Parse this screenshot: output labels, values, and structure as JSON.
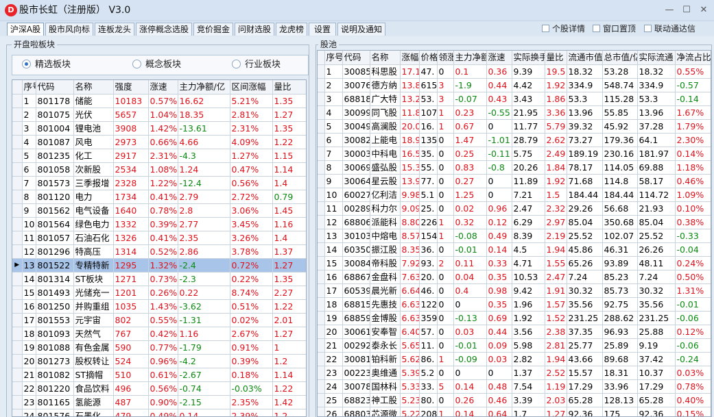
{
  "window": {
    "logo": "D",
    "title": "股市长虹（注册版） V3.0",
    "controls": {
      "minimize": "—",
      "maximize": "☐",
      "close": "✕"
    }
  },
  "tabs": [
    "沪深A股",
    "股市风向标",
    "连板龙头",
    "涨停概念选股",
    "竞价掘金",
    "问财选股",
    "龙虎榜",
    "设置",
    "说明及通知"
  ],
  "active_tab": 0,
  "options": [
    "个股详情",
    "窗口置顶",
    "联动通达信"
  ],
  "left_panel": {
    "caption": "开盘啦板块",
    "radios": [
      {
        "label": "精选板块",
        "checked": true
      },
      {
        "label": "概念板块",
        "checked": false
      },
      {
        "label": "行业板块",
        "checked": false
      }
    ],
    "columns": [
      "序号",
      "代码",
      "名称",
      "强度",
      "涨速",
      "主力净额/亿",
      "区间涨幅",
      "量比"
    ],
    "selected_index": 12,
    "rows": [
      [
        "1",
        "801178",
        "储能",
        "10183",
        "0.57%",
        "16.62",
        "5.21%",
        "1.35"
      ],
      [
        "2",
        "801075",
        "光伏",
        "5657",
        "1.04%",
        "18.35",
        "2.81%",
        "1.27"
      ],
      [
        "3",
        "801004",
        "锂电池",
        "3908",
        "1.42%",
        "-13.61",
        "2.31%",
        "1.35"
      ],
      [
        "4",
        "801087",
        "风电",
        "2973",
        "0.66%",
        "4.66",
        "4.09%",
        "1.22"
      ],
      [
        "5",
        "801235",
        "化工",
        "2917",
        "2.31%",
        "-4.3",
        "1.27%",
        "1.15"
      ],
      [
        "6",
        "801058",
        "次新股",
        "2534",
        "1.08%",
        "1.24",
        "0.47%",
        "1.14"
      ],
      [
        "7",
        "801573",
        "三季报增",
        "2328",
        "1.22%",
        "-12.4",
        "0.56%",
        "1.4"
      ],
      [
        "8",
        "801120",
        "电力",
        "1734",
        "0.41%",
        "2.79",
        "2.72%",
        "0.79"
      ],
      [
        "9",
        "801562",
        "电气设备",
        "1640",
        "0.78%",
        "2.8",
        "3.06%",
        "1.45"
      ],
      [
        "10",
        "801564",
        "绿色电力",
        "1332",
        "0.39%",
        "2.77",
        "3.45%",
        "1.16"
      ],
      [
        "11",
        "801057",
        "石油石化",
        "1326",
        "0.41%",
        "2.35",
        "3.26%",
        "1.4"
      ],
      [
        "12",
        "801296",
        "特高压",
        "1314",
        "0.52%",
        "2.86",
        "3.78%",
        "1.37"
      ],
      [
        "13",
        "801522",
        "专精特新",
        "1295",
        "1.32%",
        "-2.4",
        "0.72%",
        "1.27"
      ],
      [
        "14",
        "801314",
        "ST板块",
        "1271",
        "0.73%",
        "-2.3",
        "0.22%",
        "1.35"
      ],
      [
        "15",
        "801493",
        "光储充一",
        "1201",
        "0.26%",
        "0.22",
        "8.74%",
        "2.27"
      ],
      [
        "16",
        "801250",
        "并购重组",
        "1035",
        "1.43%",
        "-3.62",
        "0.51%",
        "1.22"
      ],
      [
        "17",
        "801553",
        "元宇宙",
        "802",
        "0.55%",
        "-1.31",
        "0.02%",
        "2.01"
      ],
      [
        "18",
        "801093",
        "天然气",
        "767",
        "0.42%",
        "1.16",
        "2.67%",
        "1.27"
      ],
      [
        "19",
        "801088",
        "有色金属",
        "590",
        "0.77%",
        "-1.79",
        "0.91%",
        "1"
      ],
      [
        "20",
        "801273",
        "股权转让",
        "524",
        "0.96%",
        "-4.2",
        "0.39%",
        "1.2"
      ],
      [
        "21",
        "801082",
        "ST摘帽",
        "510",
        "0.61%",
        "-2.67",
        "0.18%",
        "1.14"
      ],
      [
        "22",
        "801220",
        "食品饮料",
        "496",
        "0.56%",
        "-0.74",
        "-0.03%",
        "1.22"
      ],
      [
        "23",
        "801165",
        "氢能源",
        "487",
        "0.90%",
        "-2.15",
        "2.35%",
        "1.42"
      ],
      [
        "24",
        "801576",
        "石墨化",
        "479",
        "0.49%",
        "0.14",
        "2.39%",
        "1.2"
      ]
    ]
  },
  "right_panel": {
    "caption": "股池",
    "columns": [
      "序号",
      "代码",
      "名称",
      "涨幅",
      "价格",
      "领涨",
      "主力净额",
      "涨速",
      "实际换手",
      "量比",
      "流通市值",
      "总市值/亿",
      "实际流通",
      "净流占比"
    ],
    "rows": [
      [
        "1",
        "30085",
        "科思股",
        "17.1",
        "47.",
        "0",
        "0.1",
        "0.36",
        "9.39",
        "19.5",
        "18.32",
        "53.28",
        "18.32",
        "0.55%"
      ],
      [
        "2",
        "30076",
        "德方纳",
        "13.8",
        "615",
        "3",
        "-1.9",
        "0.44",
        "4.42",
        "1.92",
        "334.9",
        "548.74",
        "334.9",
        "-0.57"
      ],
      [
        "3",
        "68818",
        "广大特",
        "13.2",
        "53.",
        "3",
        "-0.07",
        "0.43",
        "3.43",
        "1.86",
        "53.3",
        "115.28",
        "53.3",
        "-0.14"
      ],
      [
        "4",
        "30099",
        "同飞股",
        "11.8",
        "107",
        "1",
        "0.23",
        "-0.55",
        "21.95",
        "3.36",
        "13.96",
        "55.85",
        "13.96",
        "1.67%"
      ],
      [
        "5",
        "30049",
        "高澜股",
        "20.0",
        "16.",
        "1",
        "0.67",
        "0",
        "11.77",
        "5.79",
        "39.32",
        "45.92",
        "37.28",
        "1.79%"
      ],
      [
        "6",
        "30082",
        "上能电",
        "18.9",
        "135",
        "0",
        "1.47",
        "-1.01",
        "28.79",
        "2.62",
        "73.27",
        "179.36",
        "64.1",
        "2.30%"
      ],
      [
        "7",
        "30003",
        "中科电",
        "16.5",
        "35.",
        "0",
        "0.25",
        "-0.11",
        "5.75",
        "2.49",
        "189.19",
        "230.16",
        "181.97",
        "0.14%"
      ],
      [
        "8",
        "30069",
        "盛弘股",
        "15.3",
        "55.",
        "0",
        "0.83",
        "-0.8",
        "20.26",
        "1.84",
        "78.17",
        "114.05",
        "69.88",
        "1.18%"
      ],
      [
        "9",
        "30064",
        "星云股",
        "13.9",
        "77.",
        "0",
        "0.27",
        "0",
        "11.89",
        "1.92",
        "71.68",
        "114.8",
        "58.17",
        "0.46%"
      ],
      [
        "10",
        "60027",
        "亿利洁",
        "9.98",
        "5.1",
        "0",
        "1.25",
        "0",
        "7.21",
        "1.5",
        "184.44",
        "184.44",
        "114.72",
        "1.09%"
      ],
      [
        "11",
        "00289",
        "科力尔",
        "9.09",
        "25.",
        "0",
        "0.02",
        "0.96",
        "2.47",
        "2.32",
        "29.26",
        "56.68",
        "21.93",
        "0.10%"
      ],
      [
        "12",
        "68806",
        "派能科",
        "8.80",
        "226",
        "1",
        "0.32",
        "0.12",
        "6.29",
        "2.97",
        "85.04",
        "350.68",
        "85.04",
        "0.38%"
      ],
      [
        "13",
        "30103",
        "中熔电",
        "8.57",
        "154",
        "1",
        "-0.08",
        "0.49",
        "8.39",
        "2.19",
        "25.52",
        "102.07",
        "25.52",
        "-0.33"
      ],
      [
        "14",
        "60350",
        "振江股",
        "8.35",
        "36.",
        "0",
        "-0.01",
        "0.14",
        "4.5",
        "1.94",
        "45.86",
        "46.31",
        "26.26",
        "-0.04"
      ],
      [
        "15",
        "30084",
        "帝科股",
        "7.92",
        "93.",
        "2",
        "0.11",
        "0.33",
        "4.71",
        "1.55",
        "65.26",
        "93.89",
        "48.11",
        "0.24%"
      ],
      [
        "16",
        "68867",
        "金盘科",
        "7.63",
        "20.",
        "0",
        "0.04",
        "0.35",
        "10.53",
        "2.47",
        "7.24",
        "85.23",
        "7.24",
        "0.50%"
      ],
      [
        "17",
        "60539",
        "晨光新",
        "6.64",
        "46.",
        "0",
        "0.4",
        "0.98",
        "9.42",
        "1.91",
        "30.32",
        "85.73",
        "30.32",
        "1.31%"
      ],
      [
        "18",
        "68815",
        "先惠技",
        "6.63",
        "122",
        "0",
        "0",
        "0.35",
        "1.96",
        "1.57",
        "35.56",
        "92.75",
        "35.56",
        "-0.01"
      ],
      [
        "19",
        "68859",
        "金博股",
        "6.63",
        "359",
        "0",
        "-0.13",
        "0.69",
        "1.92",
        "1.52",
        "231.25",
        "288.62",
        "231.25",
        "-0.06"
      ],
      [
        "20",
        "30061",
        "安奉智",
        "6.40",
        "57.",
        "0",
        "0.03",
        "0.44",
        "3.56",
        "2.38",
        "37.35",
        "96.93",
        "25.88",
        "0.12%"
      ],
      [
        "21",
        "00292",
        "泰永长",
        "5.65",
        "11.",
        "0",
        "-0.01",
        "0.09",
        "5.98",
        "2.81",
        "25.77",
        "25.89",
        "9.19",
        "-0.06"
      ],
      [
        "22",
        "30081",
        "铂科新",
        "5.62",
        "86.",
        "1",
        "-0.09",
        "0.03",
        "2.82",
        "1.94",
        "43.66",
        "89.68",
        "37.42",
        "-0.24"
      ],
      [
        "23",
        "00223",
        "奥维通",
        "5.39",
        "5.2",
        "0",
        "0",
        "0",
        "1.37",
        "2.52",
        "15.57",
        "18.31",
        "10.37",
        "0.03%"
      ],
      [
        "24",
        "30078",
        "国林科",
        "5.33",
        "33.",
        "5",
        "0.14",
        "0.48",
        "7.54",
        "1.19",
        "17.29",
        "33.96",
        "17.29",
        "0.78%"
      ],
      [
        "25",
        "68823",
        "神工股",
        "5.23",
        "80.",
        "0",
        "0.26",
        "0.46",
        "3.39",
        "2.03",
        "65.28",
        "128.13",
        "65.28",
        "0.40%"
      ],
      [
        "26",
        "68803",
        "芯源微",
        "5.22",
        "208",
        "1",
        "0.14",
        "0.64",
        "1.7",
        "1.27",
        "92.36",
        "175",
        "92.36",
        "0.15%"
      ]
    ]
  },
  "colors": {
    "up": "#e0101a",
    "down": "#0a8a10",
    "selected_row": "#a8c4e8",
    "active_tab": "#ffffff"
  }
}
